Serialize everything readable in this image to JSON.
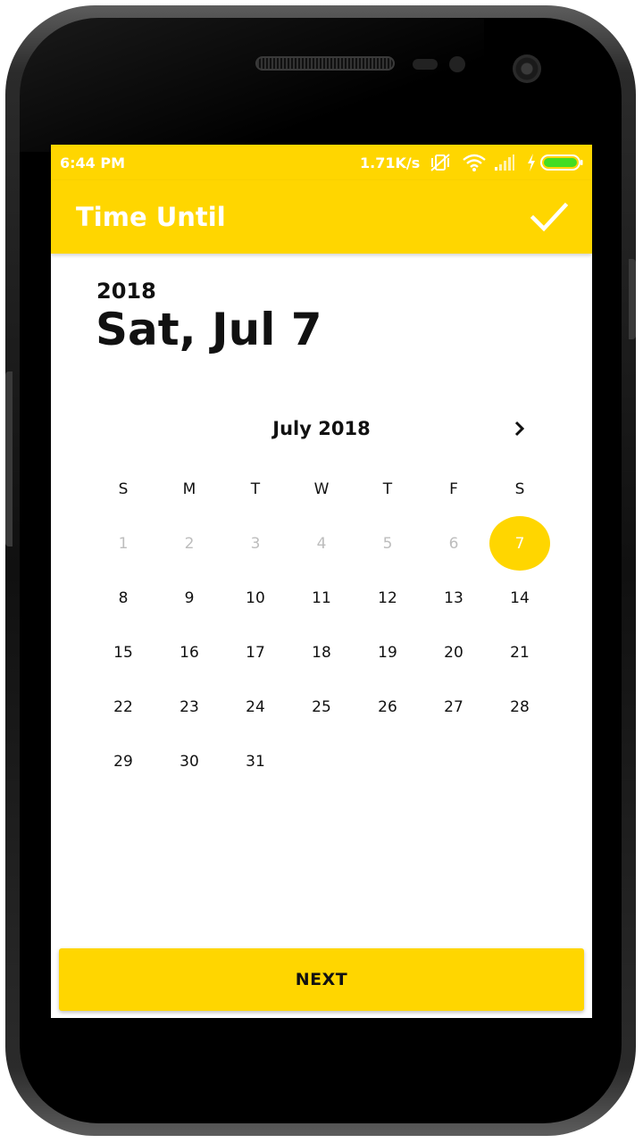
{
  "status_bar": {
    "time": "6:44 PM",
    "network_speed": "1.71K/s",
    "icons": [
      "vibrate-off-icon",
      "wifi-icon",
      "signal-icon",
      "charging-icon",
      "battery-icon"
    ]
  },
  "app_bar": {
    "title": "Time Until",
    "confirm_icon": "check-icon"
  },
  "date_header": {
    "year": "2018",
    "date": "Sat, Jul 7"
  },
  "calendar": {
    "month_title": "July 2018",
    "next_icon": "chevron-right-icon",
    "weekdays": [
      "S",
      "M",
      "T",
      "W",
      "T",
      "F",
      "S"
    ],
    "first_weekday_index": 0,
    "days_in_month": 31,
    "selected_day": 7,
    "disabled_days": [
      1,
      2,
      3,
      4,
      5,
      6
    ]
  },
  "colors": {
    "accent": "#FFD600",
    "disabled_text": "#bdbdbd",
    "text": "#111111"
  },
  "footer": {
    "next_label": "NEXT"
  }
}
